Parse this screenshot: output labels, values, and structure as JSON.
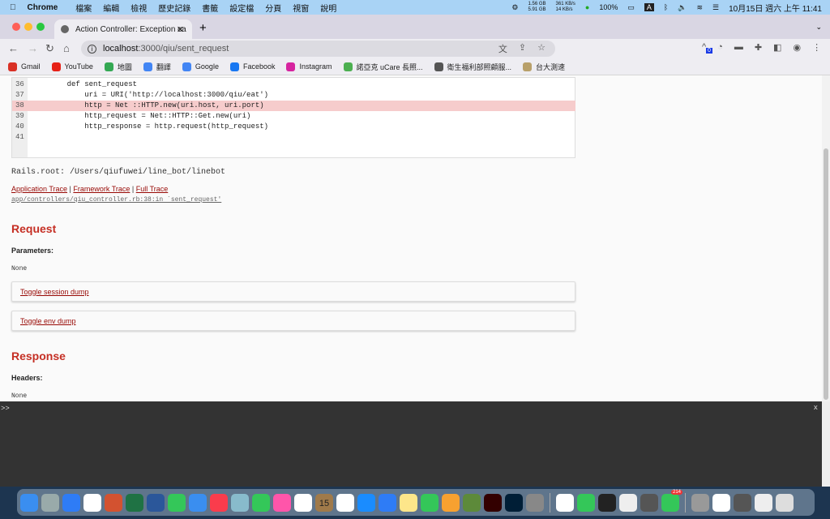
{
  "menubar": {
    "app": "Chrome",
    "items": [
      "檔案",
      "編輯",
      "檢視",
      "歷史記錄",
      "書籤",
      "設定檔",
      "分頁",
      "視窗",
      "說明"
    ],
    "mem": "1.56 GB",
    "mem2": "5.91 GB",
    "net_up": "361 KB/s",
    "net_down": "14 KB/s",
    "battery": "100%",
    "input": "A",
    "clock": "10月15日 週六 上午 11:41"
  },
  "tab": {
    "title": "Action Controller: Exception ca"
  },
  "toolbar": {
    "url_host": "localhost",
    "url_path": ":3000/qiu/sent_request",
    "ext_badge": "0"
  },
  "bookmarks": [
    {
      "label": "Gmail",
      "color": "#d93025"
    },
    {
      "label": "YouTube",
      "color": "#e62117"
    },
    {
      "label": "地圖",
      "color": "#34a853"
    },
    {
      "label": "翻譯",
      "color": "#4285f4"
    },
    {
      "label": "Google",
      "color": "#4285f4"
    },
    {
      "label": "Facebook",
      "color": "#1877f2"
    },
    {
      "label": "Instagram",
      "color": "#d6249f"
    },
    {
      "label": "諾亞克 uCare 長照...",
      "color": "#4caf50"
    },
    {
      "label": "衛生福利部照顧服...",
      "color": "#555555"
    },
    {
      "label": "台大測速",
      "color": "#b8a06a"
    }
  ],
  "code": {
    "lines": [
      {
        "n": "36",
        "c": "    def sent_request"
      },
      {
        "n": "37",
        "c": "        uri = URI('http://localhost:3000/qiu/eat')"
      },
      {
        "n": "38",
        "c": "        http = Net ::HTTP.new(uri.host, uri.port)",
        "highlight": true
      },
      {
        "n": "39",
        "c": "        http_request = Net::HTTP::Get.new(uri)"
      },
      {
        "n": "40",
        "c": "        http_response = http.request(http_request)"
      },
      {
        "n": "41",
        "c": ""
      }
    ]
  },
  "rails_root": "Rails.root: /Users/qiufuwei/line_bot/linebot",
  "traces": {
    "app": "Application Trace",
    "sep": " | ",
    "framework": "Framework Trace",
    "full": "Full Trace",
    "frame": "app/controllers/qiu_controller.rb:38:in `sent_request'"
  },
  "request": {
    "heading": "Request",
    "params_label": "Parameters",
    "params_value": "None",
    "toggle_session": "Toggle session dump",
    "toggle_env": "Toggle env dump"
  },
  "response": {
    "heading": "Response",
    "headers_label": "Headers",
    "headers_value": "None"
  },
  "console": {
    "prompt": ">>",
    "close": "x"
  },
  "dock": {
    "calendar_day": "15",
    "line_badge": "214",
    "colors": [
      "#3a8ef0",
      "#9aa",
      "#2e7cf6",
      "#fff",
      "#d35230",
      "#1f7244",
      "#2b579a",
      "#34c759",
      "#3a8ef0",
      "#fa3c4c",
      "#8bc",
      "#34c759",
      "#f5a",
      "#fff",
      "#a07a4a",
      "#fff",
      "#1a8cff",
      "#2e7cf6",
      "#fde68a",
      "#34c759",
      "#f7a130",
      "#5d8a3a",
      "#330000",
      "#001e36",
      "#888",
      "SEP",
      "#fff",
      "#34c759",
      "#222",
      "#eee",
      "#555",
      "#34c759",
      "SEP",
      "#999",
      "#fff",
      "#555",
      "#eee",
      "#ddd"
    ]
  }
}
